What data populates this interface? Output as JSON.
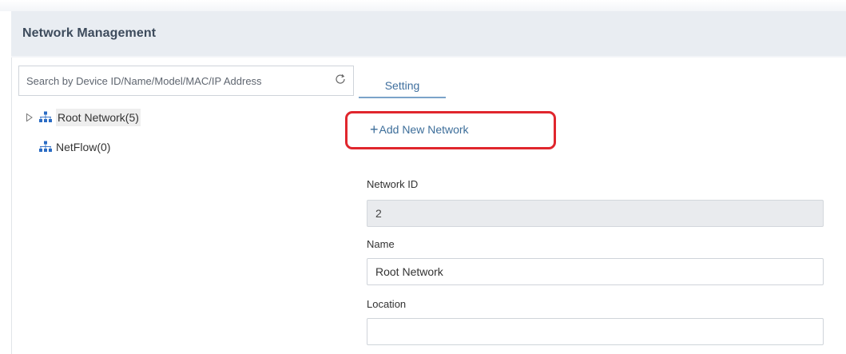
{
  "header": {
    "title": "Network Management"
  },
  "search": {
    "placeholder": "Search by Device ID/Name/Model/MAC/IP Address",
    "value": ""
  },
  "tree": {
    "items": [
      {
        "label": "Root Network(5)",
        "icon": "network-tree-icon",
        "expandable": true,
        "selected": true
      },
      {
        "label": "NetFlow(0)",
        "icon": "network-tree-icon",
        "expandable": false,
        "selected": false
      }
    ]
  },
  "tabs": [
    {
      "label": "Setting",
      "active": true
    }
  ],
  "actions": {
    "add_network_label": "Add New Network",
    "add_icon": "plus-icon"
  },
  "form": {
    "network_id": {
      "label": "Network ID",
      "value": "2",
      "readonly": true
    },
    "name": {
      "label": "Name",
      "value": "Root Network"
    },
    "location": {
      "label": "Location",
      "value": ""
    }
  },
  "colors": {
    "accent": "#3f6f9e",
    "highlight": "#e0262d",
    "header_bg": "#e9edf2"
  }
}
